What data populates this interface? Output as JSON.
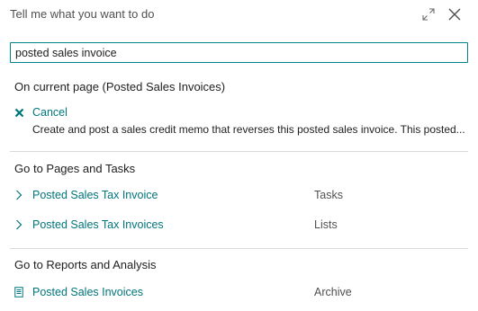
{
  "header": {
    "title": "Tell me what you want to do",
    "icons": {
      "expand": "expand-diagonal-icon",
      "close": "close-icon"
    }
  },
  "search": {
    "value": "posted sales invoice"
  },
  "current_page": {
    "title": "On current page (Posted Sales Invoices)",
    "action": {
      "icon": "cancel-x-icon",
      "label": "Cancel",
      "description": "Create and post a sales credit memo that reverses this posted sales invoice. This posted..."
    }
  },
  "pages_tasks": {
    "title": "Go to Pages and Tasks",
    "items": [
      {
        "icon": "chevron-right-icon",
        "label": "Posted Sales Tax Invoice",
        "category": "Tasks"
      },
      {
        "icon": "chevron-right-icon",
        "label": "Posted Sales Tax Invoices",
        "category": "Lists"
      }
    ]
  },
  "reports": {
    "title": "Go to Reports and Analysis",
    "items": [
      {
        "icon": "report-document-icon",
        "label": "Posted Sales Invoices",
        "category": "Archive"
      }
    ]
  },
  "colors": {
    "accent": "#00757a",
    "search_border": "#00848a",
    "cancel_icon": "#00757a",
    "divider": "#d9d9d9"
  }
}
